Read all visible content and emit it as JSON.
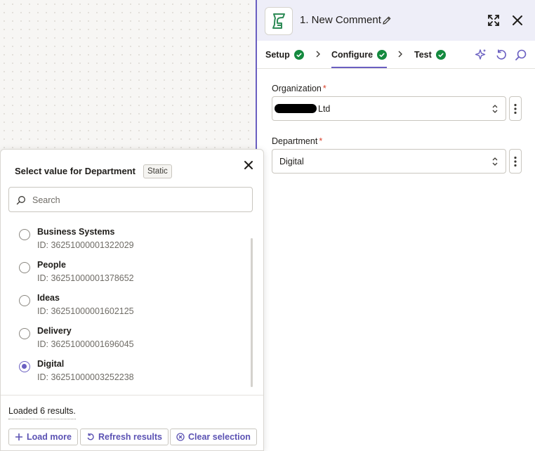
{
  "header": {
    "step_title": "1. New Comment",
    "app_icon": "zoho-desk-logo-icon"
  },
  "tabs": [
    {
      "label": "Setup",
      "status": "complete"
    },
    {
      "label": "Configure",
      "status": "complete",
      "active": true
    },
    {
      "label": "Test",
      "status": "complete"
    }
  ],
  "fields": {
    "organization": {
      "label": "Organization",
      "required_mark": "*",
      "value_suffix": "Ltd",
      "value_redacted": true
    },
    "department": {
      "label": "Department",
      "required_mark": "*",
      "value": "Digital"
    }
  },
  "popover": {
    "title": "Select value for Department",
    "badge": "Static",
    "search_placeholder": "Search",
    "options": [
      {
        "name": "Business Systems",
        "id": "ID: 36251000001322029",
        "selected": false
      },
      {
        "name": "People",
        "id": "ID: 36251000001378652",
        "selected": false
      },
      {
        "name": "Ideas",
        "id": "ID: 36251000001602125",
        "selected": false
      },
      {
        "name": "Delivery",
        "id": "ID: 36251000001696045",
        "selected": false
      },
      {
        "name": "Digital",
        "id": "ID: 36251000003252238",
        "selected": true
      }
    ],
    "status": "Loaded 6 results.",
    "buttons": {
      "load_more": "Load more",
      "refresh": "Refresh results",
      "clear": "Clear selection"
    }
  },
  "colors": {
    "accent": "#6a5fc1",
    "success": "#148a3f",
    "required": "#d9412b",
    "logo": "#2e8b57"
  }
}
